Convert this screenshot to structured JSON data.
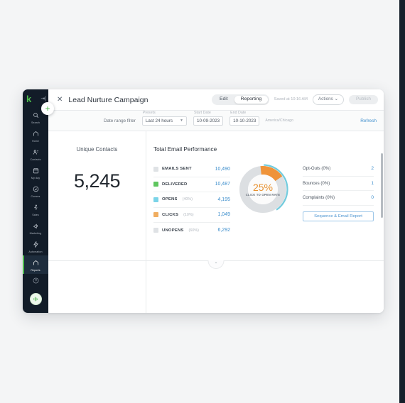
{
  "sidebar": {
    "logo": "k",
    "collapse_icon": "collapse-panel-icon",
    "items": [
      {
        "label": "Search",
        "icon": "search-icon"
      },
      {
        "label": "Home",
        "icon": "home-icon"
      },
      {
        "label": "Contacts",
        "icon": "contacts-icon"
      },
      {
        "label": "My day",
        "icon": "calendar-icon"
      },
      {
        "label": "Comms",
        "icon": "chat-icon"
      },
      {
        "label": "Sales",
        "icon": "sales-icon"
      },
      {
        "label": "Marketing",
        "icon": "marketing-icon"
      },
      {
        "label": "Automation",
        "icon": "automation-icon"
      },
      {
        "label": "Reports",
        "icon": "reports-icon",
        "active": true
      }
    ],
    "help_icon": "help-circle-icon",
    "avatar": "user-avatar"
  },
  "fab": {
    "label": "+"
  },
  "header": {
    "close_label": "✕",
    "title": "Lead Nurture Campaign",
    "tabs": [
      {
        "label": "Edit",
        "selected": false
      },
      {
        "label": "Reporting",
        "selected": true
      }
    ],
    "saved_text": "Saved at 10:16 AM",
    "actions_label": "Actions",
    "actions_caret": "⌄",
    "publish_label": "Publish"
  },
  "filters": {
    "date_range_label": "Date range filter",
    "presets_label": "Presets",
    "presets_value": "Last 24 hours",
    "start_date_label": "Start Date",
    "start_date_value": "10-09-2023",
    "end_date_label": "End Date",
    "end_date_value": "10-10-2023",
    "timezone": "America/Chicago",
    "refresh_label": "Refresh"
  },
  "unique_contacts": {
    "title": "Unique Contacts",
    "value": "5,245"
  },
  "performance": {
    "title": "Total Email Performance",
    "report_button_label": "Sequence & Email Report"
  },
  "chart_data": {
    "type": "pie",
    "title": "Total Email Performance",
    "center_value": "25%",
    "center_label": "CLICK TO OPEN RATE",
    "legend_position": "left",
    "metrics": [
      {
        "name": "EMAILS SENT",
        "percent": "",
        "value": "10,490",
        "color": "#dfe2e5"
      },
      {
        "name": "DELIVERED",
        "percent": "",
        "value": "10,487",
        "color": "#5fc65f"
      },
      {
        "name": "OPENS",
        "percent": "(40%)",
        "value": "4,195",
        "color": "#7bd4e8"
      },
      {
        "name": "CLICKS",
        "percent": "(10%)",
        "value": "1,049",
        "color": "#f0ad60"
      },
      {
        "name": "UNOPENS",
        "percent": "(60%)",
        "value": "6,292",
        "color": "#dfe2e5"
      }
    ],
    "slices": [
      {
        "name": "CLICKS",
        "value": 25,
        "color": "#ef9339"
      },
      {
        "name": "remainder",
        "value": 75,
        "color": "#dcdfe2"
      }
    ],
    "outer_arc": {
      "name": "OPENS",
      "value": 40,
      "color": "#72cbdd"
    },
    "stats": [
      {
        "name": "Opt-Outs (0%)",
        "value": "2"
      },
      {
        "name": "Bounces (0%)",
        "value": "1"
      },
      {
        "name": "Complaints (0%)",
        "value": "0"
      }
    ]
  },
  "collapse_tab": {
    "icon": "chevron-up-icon",
    "label": "⌃"
  }
}
